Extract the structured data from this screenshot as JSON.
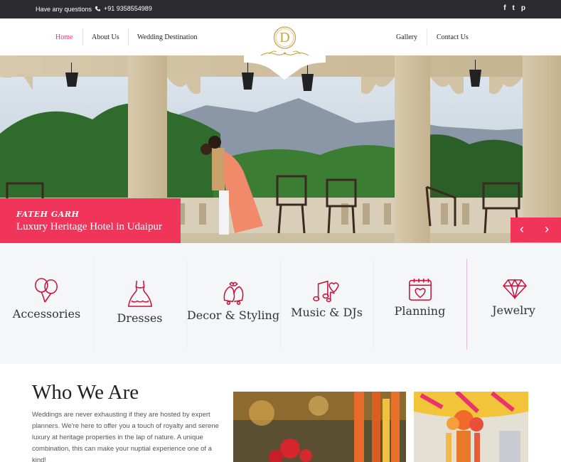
{
  "topbar": {
    "question": "Have any questions",
    "phone": "+91 9358554989",
    "social": [
      "f",
      "t",
      "p"
    ],
    "social_icons": [
      "facebook-icon",
      "twitter-icon",
      "pinterest-icon"
    ]
  },
  "nav": {
    "left": [
      "Home",
      "About Us",
      "Wedding Destination"
    ],
    "right": [
      "Gallery",
      "Contact Us"
    ],
    "active": "Home",
    "logo_letter": "D"
  },
  "hero": {
    "caption_title": "FATEH GARH",
    "caption_subtitle": "Luxury Heritage Hotel in Udaipur",
    "prev": "‹",
    "next": "›"
  },
  "services": [
    {
      "label": "Accessories",
      "icon": "balloons-icon"
    },
    {
      "label": "Dresses",
      "icon": "dress-icon"
    },
    {
      "label": "Decor & Styling",
      "icon": "bells-icon"
    },
    {
      "label": "Music & DJs",
      "icon": "music-notes-icon"
    },
    {
      "label": "Planning",
      "icon": "calendar-heart-icon"
    },
    {
      "label": "Jewelry",
      "icon": "diamond-icon"
    }
  ],
  "about": {
    "title": "Who We Are",
    "text": "Weddings are never exhausting if they are hosted by expert planners. We're here to offer you a touch of royalty and serene luxury at heritage properties in the lap of nature. A unique combination, this can make your nuptial experience one of a kind!"
  },
  "colors": {
    "accent": "#f0345a",
    "dark": "#2b2b30",
    "icon": "#c8103a",
    "gold": "#c9a24a"
  }
}
